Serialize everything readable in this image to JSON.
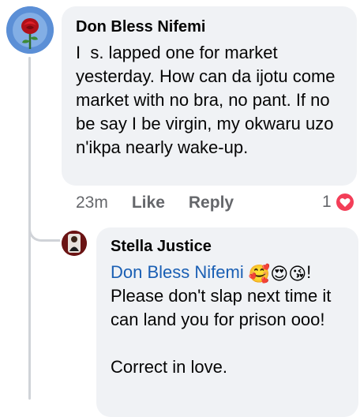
{
  "comment": {
    "author": "Don Bless Nifemi",
    "text": "I  s. lapped one for market yesterday. How can da ijotu come market with no bra, no pant. If no be say I be virgin, my okwaru uzo n'ikpa nearly wake-up.",
    "time": "23m",
    "like_label": "Like",
    "reply_label": "Reply",
    "reaction_count": "1",
    "reaction_icon": "heart-icon",
    "reaction_color": "#f33e58",
    "avatar_icon": "rose-avatar"
  },
  "reply": {
    "author": "Stella Justice",
    "mention": "Don Bless Nifemi",
    "emojis": [
      "🥰",
      "😍",
      "😘"
    ],
    "after_emoji": "!",
    "text": "Please don't slap next time it can land you for prison ooo!",
    "text2": "Correct in love.",
    "avatar_icon": "person-avatar"
  },
  "colors": {
    "bubble": "#f0f2f5",
    "mention": "#1a5fb4",
    "meta_text": "#65676b",
    "thread_line": "#d0d3d8"
  }
}
